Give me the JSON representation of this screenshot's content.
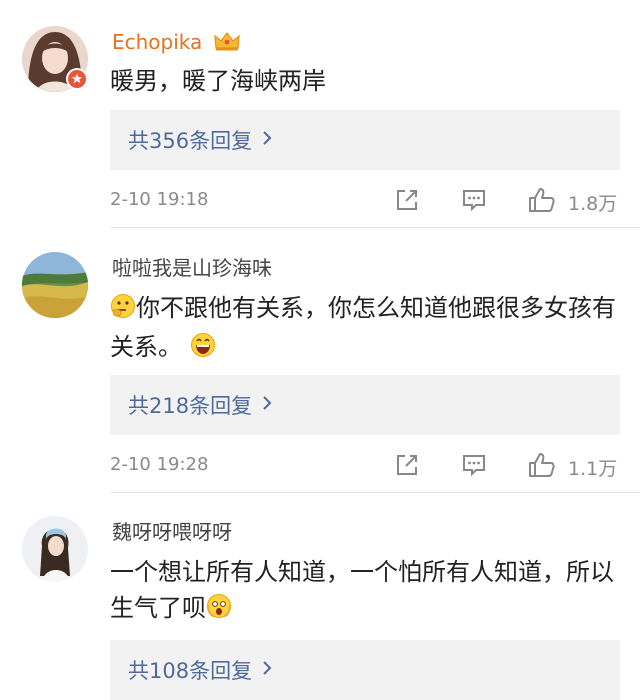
{
  "comments": [
    {
      "username": "Echopika",
      "text": "暖男，暖了海峡两岸",
      "replies_label": "共356条回复",
      "time": "2-10 19:18",
      "likes": "1.8万",
      "username_color": "#e8721c"
    },
    {
      "username": "啦啦我是山珍海味",
      "text": "你不跟他有关系，你怎么知道他跟很多女孩有关系。",
      "replies_label": "共218条回复",
      "time": "2-10 19:28",
      "likes": "1.1万",
      "username_color": "#444444"
    },
    {
      "username": "魏呀呀喂呀呀",
      "text": "一个想让所有人知道，一个怕所有人知道，所以生气了呗",
      "replies_label": "共108条回复",
      "username_color": "#444444"
    }
  ],
  "icons": [
    "crown-icon",
    "vip-badge-icon",
    "share-icon",
    "comment-icon",
    "like-icon",
    "chevron-right-icon",
    "thinking-emoji-icon",
    "grin-emoji-icon",
    "shocked-emoji-icon"
  ]
}
